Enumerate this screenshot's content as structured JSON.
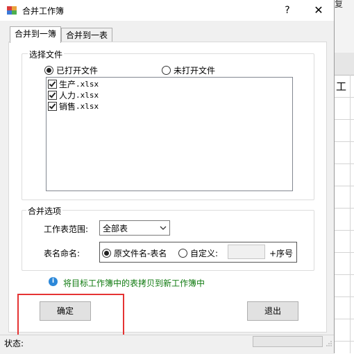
{
  "window": {
    "title": "合并工作簿",
    "help_label": "?",
    "close_label": "✕"
  },
  "background_sheet": {
    "top_text": "复",
    "cell_text": "工"
  },
  "tabs": [
    {
      "label": "合并到一簿",
      "active": true
    },
    {
      "label": "合并到一表",
      "active": false
    }
  ],
  "select_files": {
    "legend": "选择文件",
    "radio_open": {
      "label": "已打开文件",
      "checked": true
    },
    "radio_closed": {
      "label": "未打开文件",
      "checked": false
    },
    "files": [
      {
        "name": "生产",
        "ext": ".xlsx",
        "checked": true
      },
      {
        "name": "人力",
        "ext": ".xlsx",
        "checked": true
      },
      {
        "name": "销售",
        "ext": ".xlsx",
        "checked": true
      }
    ]
  },
  "merge_options": {
    "legend": "合并选项",
    "range_label": "工作表范围:",
    "range_value": "全部表",
    "naming_label": "表名命名:",
    "naming_original": {
      "label": "原文件名-表名",
      "checked": true
    },
    "naming_custom": {
      "label": "自定义:",
      "checked": false
    },
    "custom_value": "",
    "suffix_label": "+序号"
  },
  "info_text": "将目标工作簿中的表拷贝到新工作簿中",
  "buttons": {
    "ok": "确定",
    "exit": "退出"
  },
  "status": {
    "label": "状态:",
    "progress": 0
  },
  "colors": {
    "highlight": "#e53333",
    "info_text": "#0f7a0f",
    "info_icon": "#2c88d9"
  }
}
